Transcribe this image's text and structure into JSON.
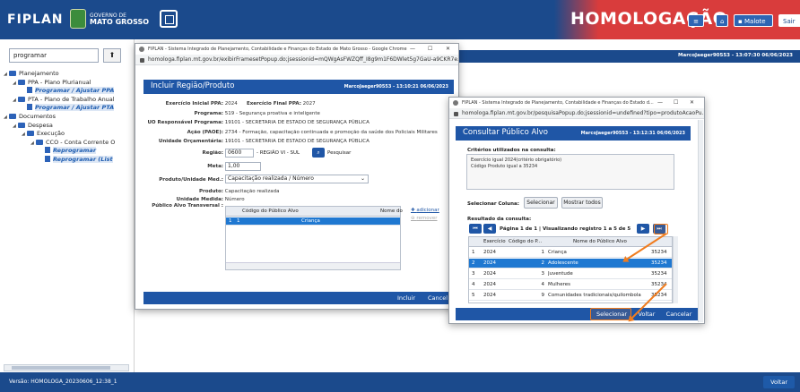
{
  "header": {
    "logo": "FIPLAN",
    "state_small": "GOVERNO DE",
    "state_big": "MATO GROSSO",
    "environment": "HOMOLOGAÇÃO",
    "menu_icon": "menu-icon",
    "home_icon": "home-icon",
    "malote_label": "Malote",
    "exit_label": "Sair"
  },
  "sidebar": {
    "search_value": "programar",
    "up_label": "⬆",
    "tree": [
      {
        "label": "Planejamento",
        "level": 0,
        "type": "folder",
        "toggle": "◢"
      },
      {
        "label": "PPA - Plano Plurianual",
        "level": 1,
        "type": "folder",
        "toggle": "◢"
      },
      {
        "label": "Programar / Ajustar PPA",
        "level": 2,
        "type": "doc",
        "selected": true
      },
      {
        "label": "PTA - Plano de Trabalho Anual",
        "level": 1,
        "type": "folder",
        "toggle": "◢"
      },
      {
        "label": "Programar / Ajustar PTA",
        "level": 2,
        "type": "doc",
        "selected": true
      },
      {
        "label": "Documentos",
        "level": 0,
        "type": "folder",
        "toggle": "◢"
      },
      {
        "label": "Despesa",
        "level": 1,
        "type": "folder",
        "toggle": "◢"
      },
      {
        "label": "Execução",
        "level": 2,
        "type": "folder",
        "toggle": "◢"
      },
      {
        "label": "CCO - Conta Corrente O",
        "level": 3,
        "type": "folder",
        "toggle": "◢"
      },
      {
        "label": "Reprogramar",
        "level": 4,
        "type": "doc",
        "selected": true
      },
      {
        "label": "Reprogramar (List",
        "level": 4,
        "type": "doc",
        "selected": true
      }
    ]
  },
  "main": {
    "user_info": "MarcoJaeger90553 - 13:07:30 06/06/2023"
  },
  "window1": {
    "chrome_title": "FIPLAN - Sistema Integrado de Planejamento, Contabilidade e Finanças do Estado de Mato Grosso - Google Chrome",
    "url": "homologa.fiplan.mt.gov.br/exibirFramesetPopup.do;jsessionid=mQWgAsFWZQff_I8g9m1F6DWlet5g7GaU-a9CKR7e...",
    "title": "Incluir Região/Produto",
    "user_info": "MarcoJaeger90553 - 13:10:21 06/06/2023",
    "fields": [
      {
        "label": "Exercício Inicial PPA:",
        "value": "2024"
      },
      {
        "label": "Exercício Final PPA:",
        "value": "2027"
      },
      {
        "label": "Programa:",
        "value": "519 - Segurança proativa e inteligente"
      },
      {
        "label": "UO Responsável Programa:",
        "value": "19101 - SECRETARIA DE ESTADO DE SEGURANÇA PÚBLICA"
      },
      {
        "label": "Ação (PAOE):",
        "value": "2734 - Formação, capacitação continuada e promoção da saúde dos Policiais Militares"
      },
      {
        "label": "Unidade Orçamentária:",
        "value": "19101 - SECRETARIA DE ESTADO DE SEGURANÇA PÚBLICA"
      },
      {
        "label": "Região:",
        "value": "0600"
      },
      {
        "label": "Meta:",
        "value": "1,00"
      },
      {
        "label": "Produto/Unidade Med.:",
        "value": "Capacitação realizada / Número"
      },
      {
        "label": "Produto:",
        "value": "Capacitação realizada"
      },
      {
        "label": "Unidade Medida:",
        "value": "Número"
      },
      {
        "label": "Público Alvo Transversal :",
        "value": ""
      }
    ],
    "regiao_desc": "- REGIÃO VI - SUL",
    "pesquisar_label": "Pesquisar",
    "grid_headers": [
      "Código do Público Alvo",
      "Nome do"
    ],
    "grid_rows": [
      {
        "n": "1",
        "codigo": "1",
        "nome": "Criança"
      }
    ],
    "adicionar_label": "adicionar",
    "remover_label": "remover",
    "incluir_label": "Incluir",
    "cancelar_label": "Cancel"
  },
  "window2": {
    "chrome_title": "FIPLAN - Sistema Integrado de Planejamento, Contabilidade e Finanças do Estado d...",
    "url": "homologa.fiplan.mt.gov.br/pesquisaPopup.do;jsessionid=undefined?tipo=produtoAcaoPu...",
    "title": "Consultar Público Alvo",
    "user_info": "MarcoJaeger90553 - 13:12:31 06/06/2023",
    "criteria_label": "Critérios utilizados na consulta:",
    "criteria_lines": [
      "Exercício igual 2024(critério obrigatório)",
      "Código Produto igual a 35234"
    ],
    "select_column_label": "Selecionar Coluna:",
    "selecionar_btn": "Selecionar",
    "mostrar_todos_btn": "Mostrar todos",
    "result_label": "Resultado da consulta:",
    "pager_text": "Página 1 de 1 | Visualizando registro 1 a 5 de 5",
    "grid_headers": [
      "Exercício",
      "Código do P...",
      "Nome do Público Alvo",
      ""
    ],
    "rows": [
      {
        "n": "1",
        "exercicio": "2024",
        "codigo": "1",
        "nome": "Criança",
        "extra": "35234",
        "selected": false
      },
      {
        "n": "2",
        "exercicio": "2024",
        "codigo": "2",
        "nome": "Adolescente",
        "extra": "35234",
        "selected": true
      },
      {
        "n": "3",
        "exercicio": "2024",
        "codigo": "3",
        "nome": "Juventude",
        "extra": "35234",
        "selected": false
      },
      {
        "n": "4",
        "exercicio": "2024",
        "codigo": "4",
        "nome": "Mulheres",
        "extra": "35234",
        "selected": false
      },
      {
        "n": "5",
        "exercicio": "2024",
        "codigo": "9",
        "nome": "Comunidades tradicionais/quilombola",
        "extra": "35234",
        "selected": false
      }
    ],
    "footer_selecionar": "Selecionar",
    "footer_voltar": "Voltar",
    "footer_cancelar": "Cancelar"
  },
  "footer": {
    "version": "Versão: HOMOLOGA_20230606_12:38_1",
    "back_label": "Voltar"
  },
  "colors": {
    "primary": "#1b4a8c",
    "environment_red": "#d93c3c",
    "selection": "#1f78d1",
    "annotation": "#f07c1e"
  }
}
